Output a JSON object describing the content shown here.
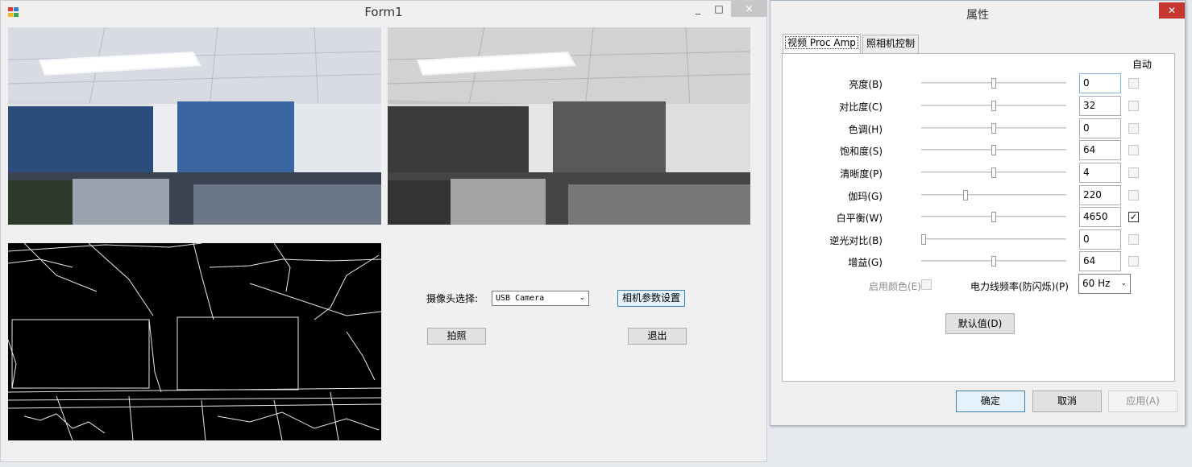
{
  "form1": {
    "title": "Form1",
    "min_glyph": "_",
    "max_glyph": "□",
    "close_glyph": "✕",
    "camera_label": "摄像头选择:",
    "camera_value": "USB Camera",
    "settings_button": "相机参数设置",
    "capture_button": "拍照",
    "exit_button": "退出"
  },
  "dialog": {
    "title": "属性",
    "close_glyph": "✕",
    "tabs": [
      "视频 Proc Amp",
      "照相机控制"
    ],
    "auto_header": "自动",
    "properties": [
      {
        "label": "亮度(B)",
        "value": "0",
        "slider": 0.5,
        "auto": false
      },
      {
        "label": "对比度(C)",
        "value": "32",
        "slider": 0.5,
        "auto": false
      },
      {
        "label": "色调(H)",
        "value": "0",
        "slider": 0.5,
        "auto": false
      },
      {
        "label": "饱和度(S)",
        "value": "64",
        "slider": 0.5,
        "auto": false
      },
      {
        "label": "清晰度(P)",
        "value": "4",
        "slider": 0.5,
        "auto": false
      },
      {
        "label": "伽玛(G)",
        "value": "220",
        "slider": 0.3,
        "auto": false
      },
      {
        "label": "白平衡(W)",
        "value": "4650",
        "slider": 0.5,
        "auto": true
      },
      {
        "label": "逆光对比(B)",
        "value": "0",
        "slider": 0.0,
        "auto": false
      },
      {
        "label": "增益(G)",
        "value": "64",
        "slider": 0.5,
        "auto": false
      }
    ],
    "enable_color_label": "启用颜色(E)",
    "powerline_label": "电力线频率(防闪烁)(P)",
    "powerline_value": "60 Hz",
    "default_button": "默认值(D)",
    "ok_button": "确定",
    "cancel_button": "取消",
    "apply_button": "应用(A)",
    "checkmark": "✓",
    "dropdown_glyph": "⌄"
  },
  "colors": {
    "accent": "#3c7fb1",
    "close_red": "#c7372f"
  }
}
